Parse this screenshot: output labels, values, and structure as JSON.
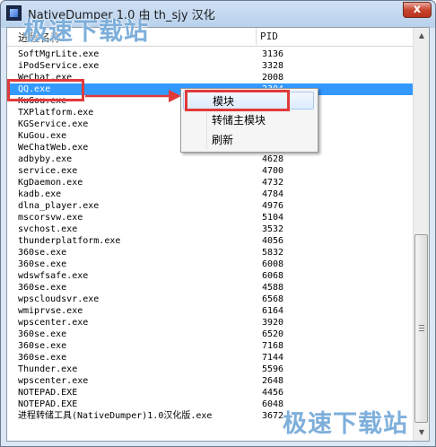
{
  "window": {
    "title": "NativeDumper 1.0 由 th_sjy 汉化",
    "close_glyph": "x"
  },
  "list": {
    "col_name": "进程名称",
    "col_pid": "PID",
    "rows": [
      {
        "name": "SoftMgrLite.exe",
        "pid": "3136"
      },
      {
        "name": "iPodService.exe",
        "pid": "3328"
      },
      {
        "name": "WeChat.exe",
        "pid": "2008"
      },
      {
        "name": "QQ.exe",
        "pid": "2304",
        "selected": true
      },
      {
        "name": "KuGou.exe",
        "pid": ""
      },
      {
        "name": "TXPlatform.exe",
        "pid": ""
      },
      {
        "name": "KGService.exe",
        "pid": ""
      },
      {
        "name": "KuGou.exe",
        "pid": ""
      },
      {
        "name": "WeChatWeb.exe",
        "pid": ""
      },
      {
        "name": "adbyby.exe",
        "pid": "4628"
      },
      {
        "name": "service.exe",
        "pid": "4700"
      },
      {
        "name": "KgDaemon.exe",
        "pid": "4732"
      },
      {
        "name": "kadb.exe",
        "pid": "4784"
      },
      {
        "name": "dlna_player.exe",
        "pid": "4976"
      },
      {
        "name": "mscorsvw.exe",
        "pid": "5104"
      },
      {
        "name": "svchost.exe",
        "pid": "3532"
      },
      {
        "name": "thunderplatform.exe",
        "pid": "4056"
      },
      {
        "name": "360se.exe",
        "pid": "5832"
      },
      {
        "name": "360se.exe",
        "pid": "6008"
      },
      {
        "name": "wdswfsafe.exe",
        "pid": "6068"
      },
      {
        "name": "360se.exe",
        "pid": "4588"
      },
      {
        "name": "wpscloudsvr.exe",
        "pid": "6568"
      },
      {
        "name": "wmiprvse.exe",
        "pid": "6164"
      },
      {
        "name": "wpscenter.exe",
        "pid": "3920"
      },
      {
        "name": "360se.exe",
        "pid": "6520"
      },
      {
        "name": "360se.exe",
        "pid": "7168"
      },
      {
        "name": "360se.exe",
        "pid": "7144"
      },
      {
        "name": "Thunder.exe",
        "pid": "5596"
      },
      {
        "name": "wpscenter.exe",
        "pid": "2648"
      },
      {
        "name": "NOTEPAD.EXE",
        "pid": "4456"
      },
      {
        "name": "NOTEPAD.EXE",
        "pid": "6048"
      },
      {
        "name": "进程转储工具(NativeDumper)1.0汉化版.exe",
        "pid": "3672"
      }
    ]
  },
  "context_menu": {
    "items": [
      {
        "label": "模块",
        "highlighted": true
      },
      {
        "label": "转储主模块"
      },
      {
        "label": "刷新"
      }
    ]
  },
  "watermarks": [
    "极速下载站",
    "极速下载站"
  ],
  "colors": {
    "selection": "#3399ff",
    "annotation_red": "#e03a3a",
    "watermark": "#146ebe"
  },
  "scrollbar": {
    "up_glyph": "▲",
    "down_glyph": "▼",
    "position_fraction": 0.5
  }
}
